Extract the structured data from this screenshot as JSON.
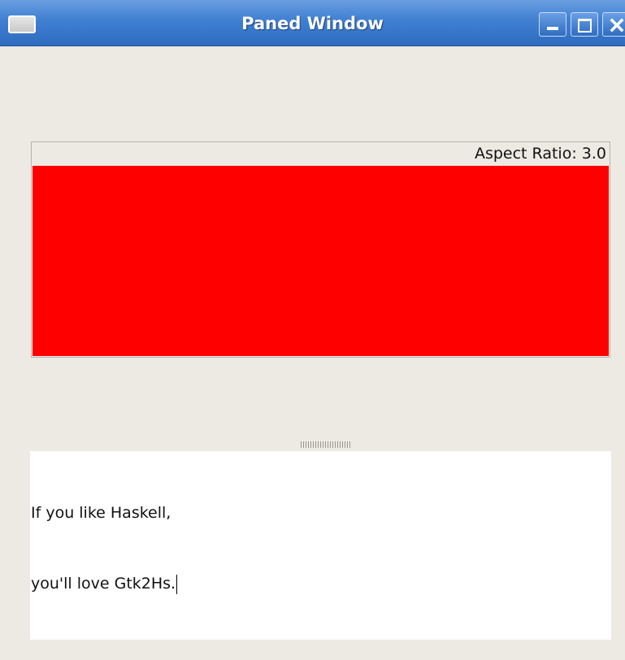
{
  "window": {
    "title": "Paned Window"
  },
  "aspect_frame": {
    "label": "Aspect Ratio: 3.0",
    "area_color": "#ff0000"
  },
  "text_view": {
    "lines": [
      "If you like Haskell,",
      "you'll love Gtk2Hs."
    ]
  },
  "icons": {
    "window_menu": "window-menu-icon",
    "minimize": "minimize-icon",
    "maximize": "maximize-icon",
    "close": "close-icon"
  },
  "colors": {
    "titlebar": "#3f7fd2",
    "window_bg": "#edeae4",
    "red_area": "#ff0000"
  }
}
